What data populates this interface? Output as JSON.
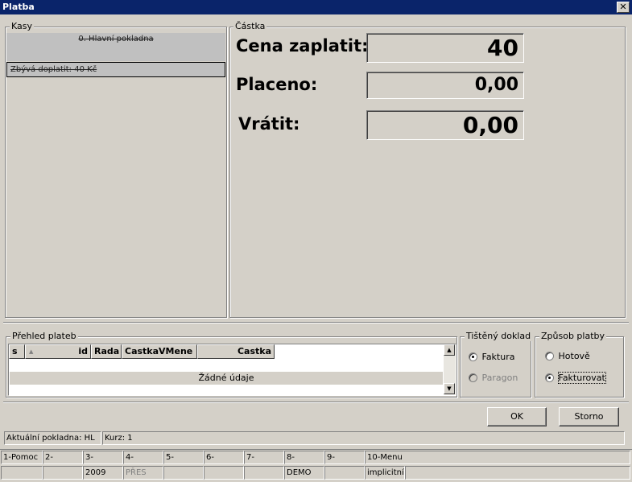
{
  "window": {
    "title": "Platba",
    "close_symbol": "✕"
  },
  "kasy": {
    "legend": "Kasy",
    "item_name": "0. Hlavní pokladna",
    "item_remaining": "Zbývá doplatit:  40 Kč"
  },
  "castka": {
    "legend": "Částka",
    "cena_label": "Cena zaplatit:",
    "cena_value": "40",
    "placeno_label": "Placeno:",
    "placeno_value": "0,00",
    "vratit_label": "Vrátit:",
    "vratit_value": "0,00"
  },
  "prehled": {
    "legend": "Přehled plateb",
    "columns": [
      "s",
      "id",
      "Rada",
      "CastkaVMene",
      "Castka"
    ],
    "sort_indicator": "▲",
    "empty_text": "Žádné údaje"
  },
  "doklad": {
    "legend": "Tištěný doklad",
    "options": [
      "Faktura",
      "Paragon"
    ],
    "selected": "Faktura"
  },
  "zpusob": {
    "legend": "Způsob platby",
    "options": [
      "Hotově",
      "Fakturovat"
    ],
    "selected": "Fakturovat"
  },
  "buttons": {
    "ok": "OK",
    "storno": "Storno"
  },
  "status": {
    "pokladna": "Aktuální pokladna: HL",
    "kurz": "Kurz: 1"
  },
  "fkeys": {
    "top": [
      "1-Pomoc",
      "2-",
      "3-",
      "4-",
      "5-",
      "6-",
      "7-",
      "8-",
      "9-",
      "10-Menu"
    ],
    "bottom": [
      "",
      "",
      "2009",
      "PŘES",
      "",
      "",
      "",
      "DEMO",
      "",
      "implicitní"
    ]
  }
}
